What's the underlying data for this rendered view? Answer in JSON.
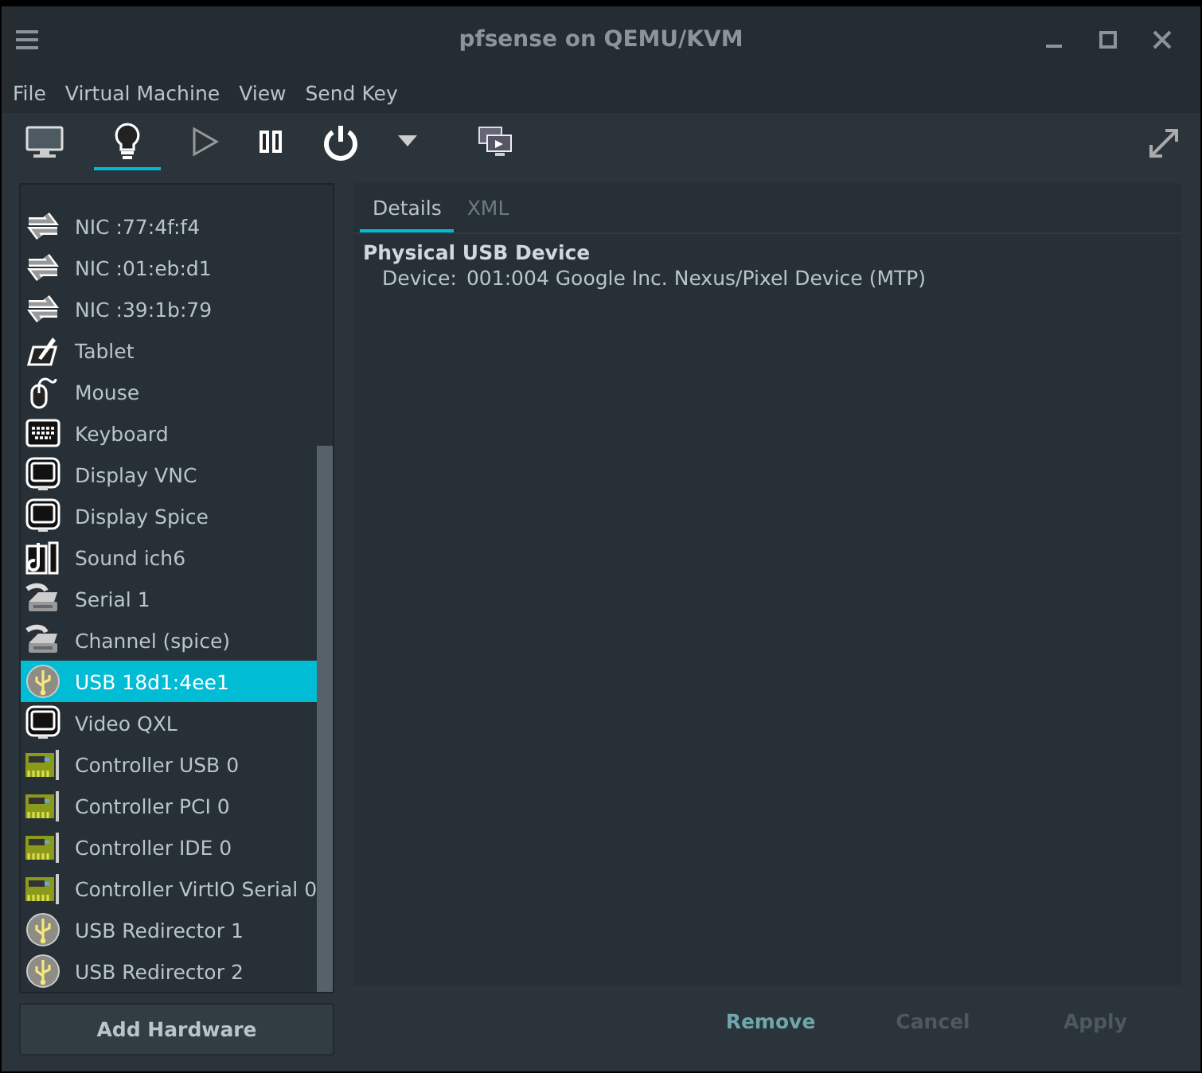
{
  "window": {
    "title": "pfsense on QEMU/KVM"
  },
  "menu": [
    "File",
    "Virtual Machine",
    "View",
    "Send Key"
  ],
  "toolbar": [
    {
      "kind": "console",
      "selected": false
    },
    {
      "kind": "details",
      "selected": true
    },
    {
      "kind": "run",
      "selected": false
    },
    {
      "kind": "pause",
      "selected": false
    },
    {
      "kind": "power",
      "selected": false
    },
    {
      "kind": "dropdown",
      "selected": false
    },
    {
      "kind": "snapshots",
      "selected": false
    }
  ],
  "devices": [
    {
      "label": "NIC :77:4f:f4",
      "kind": "nic",
      "selected": false
    },
    {
      "label": "NIC :01:eb:d1",
      "kind": "nic",
      "selected": false
    },
    {
      "label": "NIC :39:1b:79",
      "kind": "nic",
      "selected": false
    },
    {
      "label": "Tablet",
      "kind": "tablet",
      "selected": false
    },
    {
      "label": "Mouse",
      "kind": "mouse",
      "selected": false
    },
    {
      "label": "Keyboard",
      "kind": "keyboard",
      "selected": false
    },
    {
      "label": "Display VNC",
      "kind": "display",
      "selected": false
    },
    {
      "label": "Display Spice",
      "kind": "display",
      "selected": false
    },
    {
      "label": "Sound ich6",
      "kind": "sound",
      "selected": false
    },
    {
      "label": "Serial 1",
      "kind": "serial",
      "selected": false
    },
    {
      "label": "Channel (spice)",
      "kind": "serial",
      "selected": false
    },
    {
      "label": "USB 18d1:4ee1",
      "kind": "usb",
      "selected": true
    },
    {
      "label": "Video QXL",
      "kind": "display",
      "selected": false
    },
    {
      "label": "Controller USB 0",
      "kind": "controller",
      "selected": false
    },
    {
      "label": "Controller PCI 0",
      "kind": "controller",
      "selected": false
    },
    {
      "label": "Controller IDE 0",
      "kind": "controller",
      "selected": false
    },
    {
      "label": "Controller VirtIO Serial 0",
      "kind": "controller",
      "selected": false
    },
    {
      "label": "USB Redirector 1",
      "kind": "usb",
      "selected": false
    },
    {
      "label": "USB Redirector 2",
      "kind": "usb",
      "selected": false
    }
  ],
  "add_button": "Add Hardware",
  "tabs": [
    {
      "label": "Details",
      "selected": true
    },
    {
      "label": "XML",
      "selected": false
    }
  ],
  "details": {
    "heading": "Physical USB Device",
    "fields": [
      {
        "label": "Device:",
        "value": "001:004 Google Inc. Nexus/Pixel Device (MTP)"
      }
    ]
  },
  "actions": [
    {
      "label": "Remove",
      "disabled": false
    },
    {
      "label": "Cancel",
      "disabled": true
    },
    {
      "label": "Apply",
      "disabled": true
    }
  ]
}
